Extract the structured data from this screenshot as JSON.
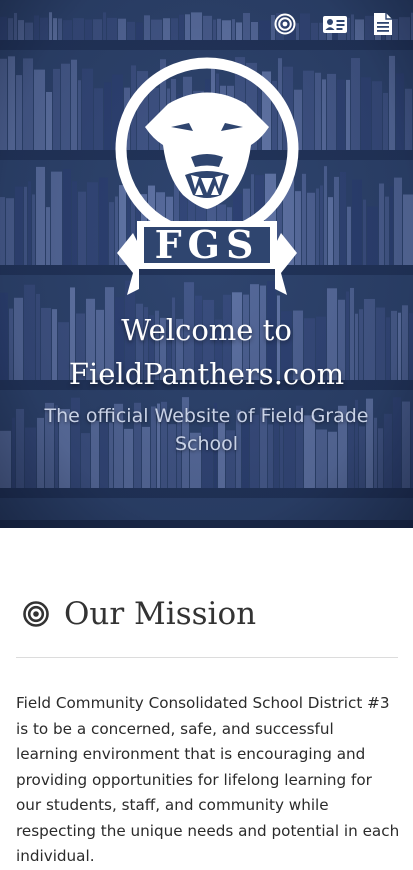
{
  "header": {
    "icons": [
      "target-icon",
      "contact-card-icon",
      "document-icon"
    ]
  },
  "hero": {
    "logo_text": "FGS",
    "welcome_line1": "Welcome to",
    "welcome_line2": "FieldPanthers.com",
    "subtitle": "The official Website of Field Grade School"
  },
  "mission": {
    "icon": "target-icon",
    "title": "Our Mission",
    "text": "Field Community Consolidated School District #3 is to be a concerned, safe, and successful learning environment that is encouraging and providing opportunities for lifelong learning for our students, staff, and community while respecting the unique needs and potential in each individual."
  },
  "colors": {
    "hero_overlay": "#2f456f",
    "heading": "#333333",
    "body_text": "#2b2b2b"
  }
}
